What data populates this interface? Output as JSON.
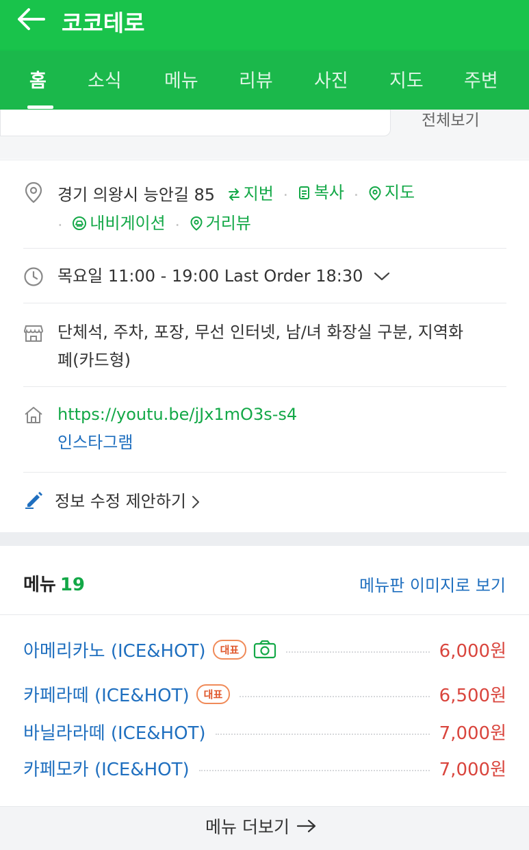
{
  "header": {
    "title": "코코테로"
  },
  "tabs": [
    "홈",
    "소식",
    "메뉴",
    "리뷰",
    "사진",
    "지도",
    "주변"
  ],
  "peek": {
    "link": "전체보기"
  },
  "info": {
    "address": "경기 의왕시 능안길 85",
    "address_actions": [
      "지번",
      "복사",
      "지도",
      "내비게이션",
      "거리뷰"
    ],
    "hours": "목요일 11:00 - 19:00 Last Order 18:30",
    "amenities_line1": "단체석, 주차, 포장, 무선 인터넷, 남/녀 화장실 구분, 지역화",
    "amenities_line2": "폐(카드형)",
    "website": "https://youtu.be/jJx1mO3s-s4",
    "instagram": "인스타그램",
    "edit_suggest": "정보 수정 제안하기"
  },
  "menu": {
    "title": "메뉴",
    "count": "19",
    "image_link": "메뉴판 이미지로 보기",
    "items": [
      {
        "name": "아메리카노 (ICE&HOT)",
        "badge": "대표",
        "price": "6,000원"
      },
      {
        "name": "카페라떼 (ICE&HOT)",
        "badge": "대표",
        "price": "6,500원"
      },
      {
        "name": "바닐라라떼 (ICE&HOT)",
        "badge": "",
        "price": "7,000원"
      },
      {
        "name": "카페모카 (ICE&HOT)",
        "badge": "",
        "price": "7,000원"
      }
    ],
    "more": "메뉴 더보기"
  },
  "colors": {
    "brand_green": "#19c34b",
    "link_blue": "#1f6fbf",
    "price_red": "#d9453d",
    "badge_orange": "#e0572b"
  }
}
